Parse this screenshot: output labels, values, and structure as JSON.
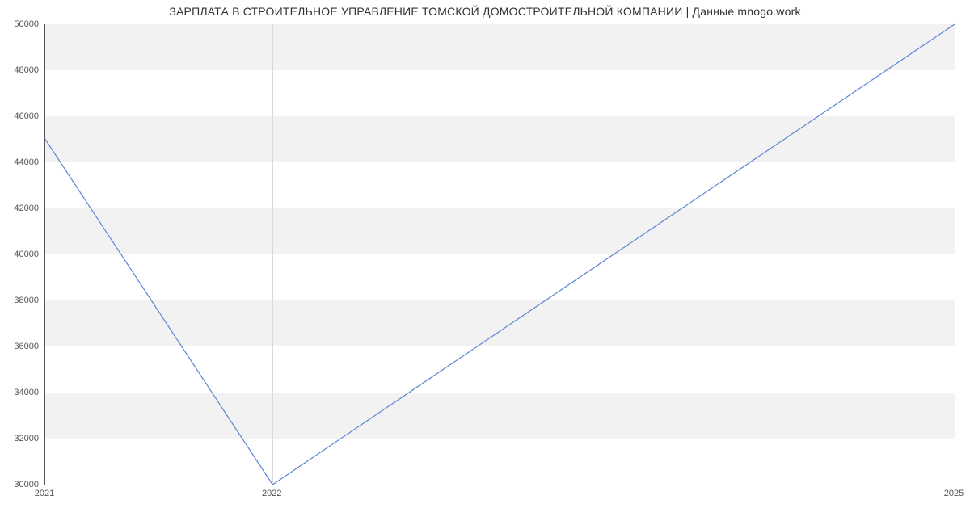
{
  "chart_data": {
    "type": "line",
    "title": "ЗАРПЛАТА В  СТРОИТЕЛЬНОЕ УПРАВЛЕНИЕ ТОМСКОЙ ДОМОСТРОИТЕЛЬНОЙ КОМПАНИИ | Данные mnogo.work",
    "x": [
      2021,
      2022,
      2025
    ],
    "y": [
      45000,
      30000,
      50000
    ],
    "x_ticks": [
      2021,
      2022,
      2025
    ],
    "y_ticks": [
      30000,
      32000,
      34000,
      36000,
      38000,
      40000,
      42000,
      44000,
      46000,
      48000,
      50000
    ],
    "xlim": [
      2021,
      2025
    ],
    "ylim": [
      30000,
      50000
    ],
    "xlabel": "",
    "ylabel": "",
    "line_color": "#5c85d6"
  }
}
